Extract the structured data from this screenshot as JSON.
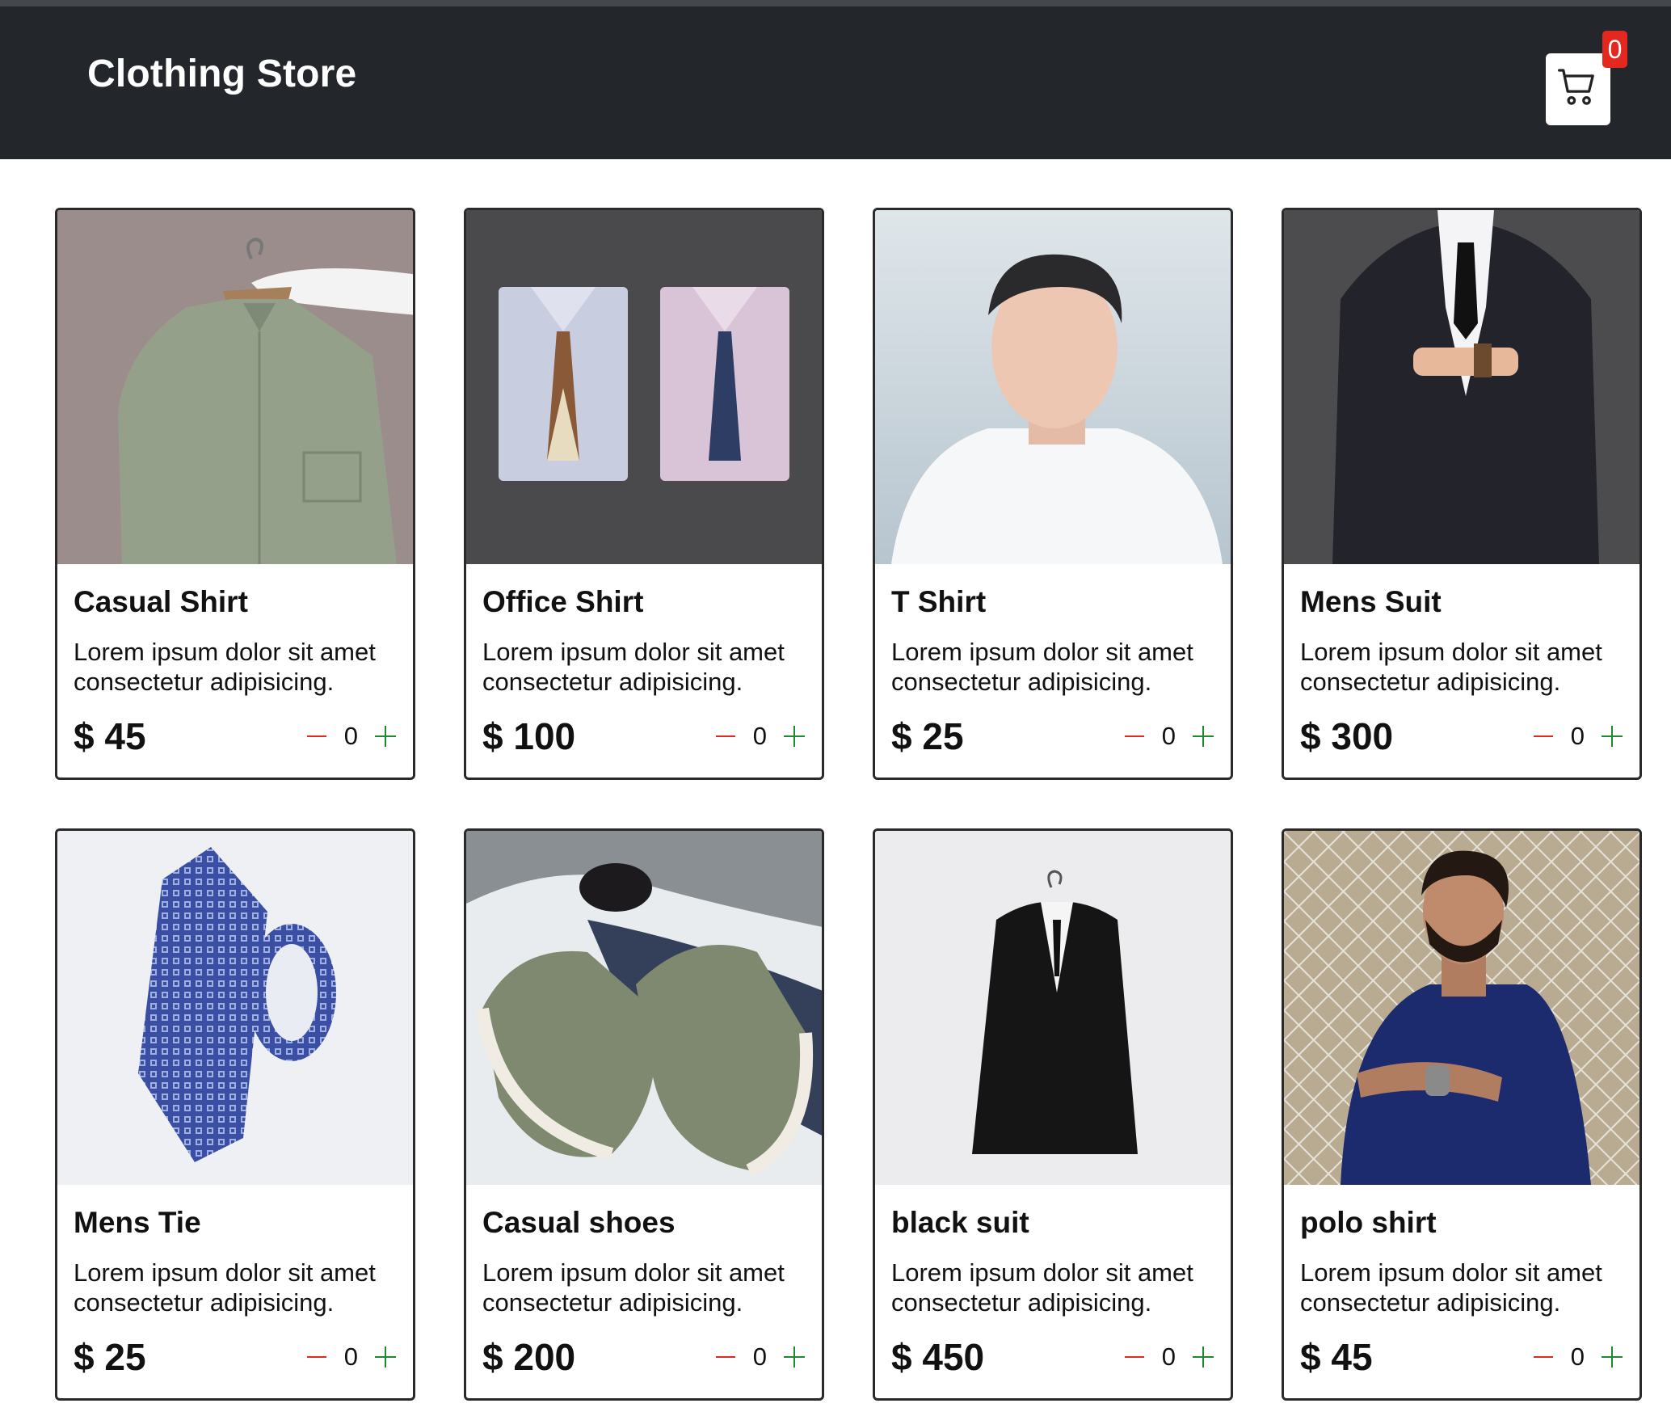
{
  "header": {
    "title": "Clothing Store",
    "cart_count": "0"
  },
  "colors": {
    "navbar": "#23272b",
    "badge": "#e2281f",
    "minus": "#e2281f",
    "plus": "#1e8a2b"
  },
  "products": [
    {
      "name": "Casual Shirt",
      "description": "Lorem ipsum dolor sit amet consectetur adipisicing.",
      "price": "$ 45",
      "qty": "0"
    },
    {
      "name": "Office Shirt",
      "description": "Lorem ipsum dolor sit amet consectetur adipisicing.",
      "price": "$ 100",
      "qty": "0"
    },
    {
      "name": "T Shirt",
      "description": "Lorem ipsum dolor sit amet consectetur adipisicing.",
      "price": "$ 25",
      "qty": "0"
    },
    {
      "name": "Mens Suit",
      "description": "Lorem ipsum dolor sit amet consectetur adipisicing.",
      "price": "$ 300",
      "qty": "0"
    },
    {
      "name": "Mens Tie",
      "description": "Lorem ipsum dolor sit amet consectetur adipisicing.",
      "price": "$ 25",
      "qty": "0"
    },
    {
      "name": "Casual shoes",
      "description": "Lorem ipsum dolor sit amet consectetur adipisicing.",
      "price": "$ 200",
      "qty": "0"
    },
    {
      "name": "black suit",
      "description": "Lorem ipsum dolor sit amet consectetur adipisicing.",
      "price": "$ 450",
      "qty": "0"
    },
    {
      "name": "polo shirt",
      "description": "Lorem ipsum dolor sit amet consectetur adipisicing.",
      "price": "$ 45",
      "qty": "0"
    }
  ]
}
